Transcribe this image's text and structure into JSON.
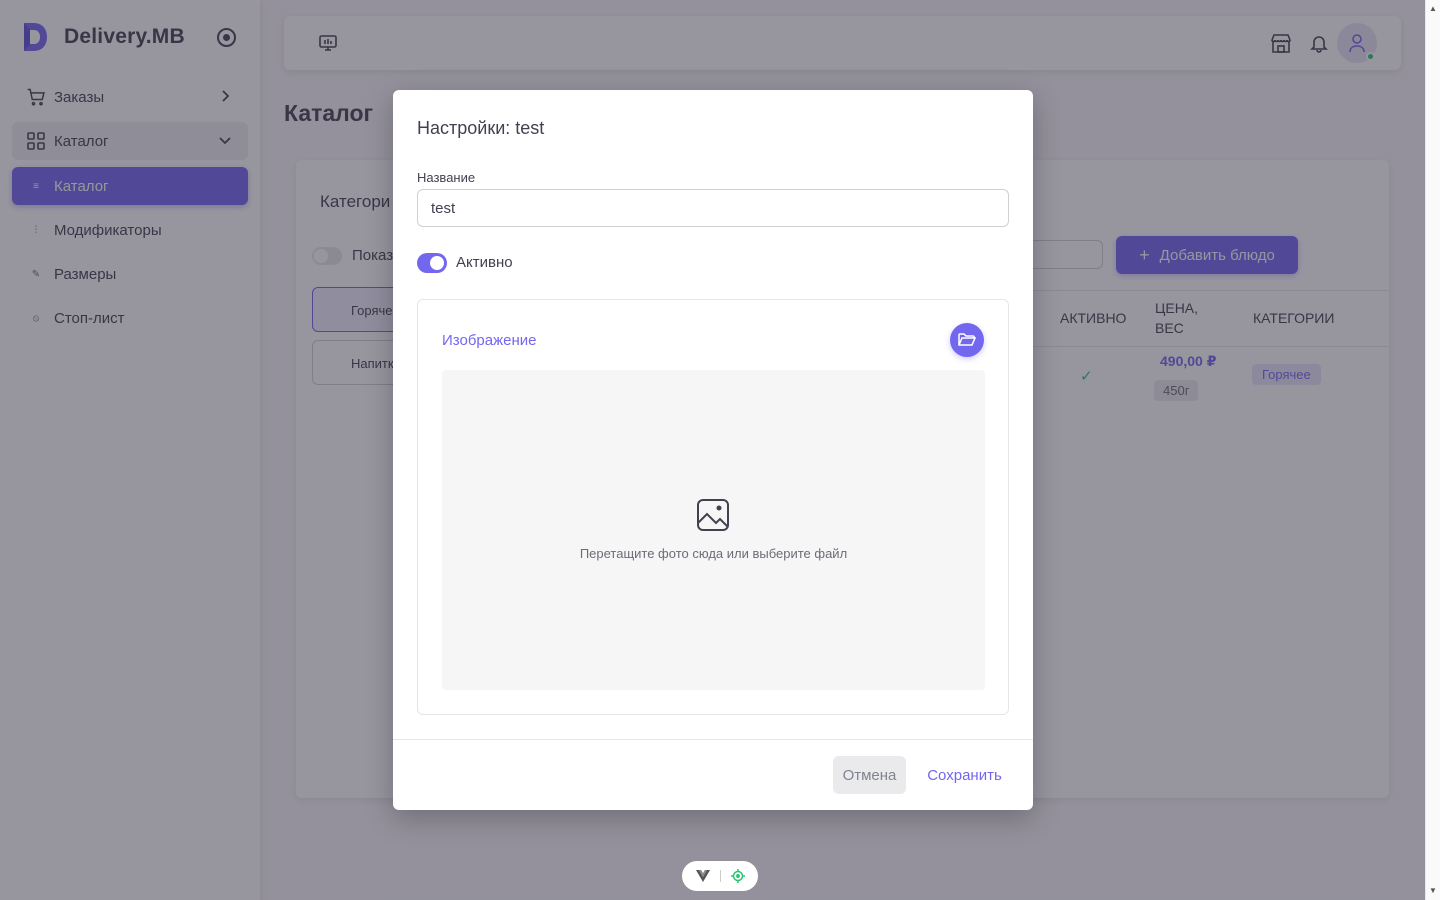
{
  "brand": {
    "name": "Delivery.MB"
  },
  "sidebar": {
    "items": [
      {
        "label": "Заказы",
        "icon": "cart-icon"
      },
      {
        "label": "Каталог",
        "icon": "grid-icon"
      },
      {
        "label": "Каталог",
        "icon": "list-icon"
      },
      {
        "label": "Модификаторы",
        "icon": "sliders-icon"
      },
      {
        "label": "Размеры",
        "icon": "pencil-icon"
      },
      {
        "label": "Стоп-лист",
        "icon": "ban-icon"
      }
    ]
  },
  "page": {
    "title": "Каталог"
  },
  "background_card": {
    "title": "Категори",
    "show_label": "Показ",
    "categories": [
      "Горяче",
      "Напитк"
    ],
    "add_button": "Добавить блюдо",
    "columns": {
      "active": "АКТИВНО",
      "price_line1": "ЦЕНА,",
      "price_line2": "ВЕС",
      "categories": "КАТЕГОРИИ"
    },
    "row": {
      "price": "490,00 ₽",
      "weight": "450г",
      "category": "Горячее"
    }
  },
  "modal": {
    "title": "Настройки: test",
    "name_label": "Название",
    "name_value": "test",
    "active_label": "Активно",
    "image_title": "Изображение",
    "drop_text": "Перетащите фото сюда или выберите файл",
    "cancel": "Отмена",
    "save": "Сохранить"
  },
  "colors": {
    "primary": "#7367f0",
    "success": "#28c76f",
    "text": "#444050",
    "overlay": "rgba(47,43,61,0.5)"
  }
}
